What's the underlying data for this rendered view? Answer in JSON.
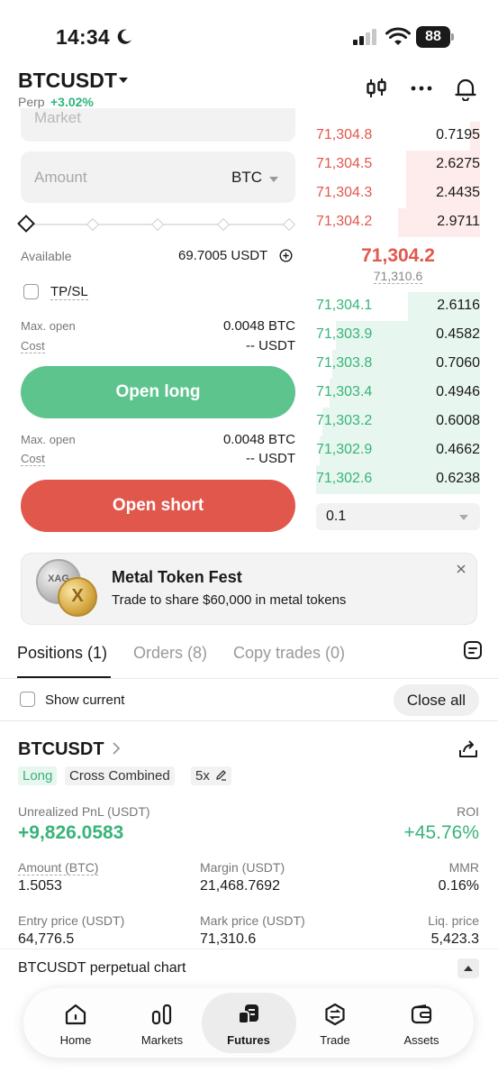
{
  "status": {
    "time": "14:34",
    "battery": "88"
  },
  "header": {
    "symbol": "BTCUSDT",
    "contract": "Perp",
    "change": "+3.02%"
  },
  "form": {
    "order_type": "Market",
    "amount_placeholder": "Amount",
    "amount_unit": "BTC",
    "available_label": "Available",
    "available_value": "69.7005 USDT",
    "tpsl_label": "TP/SL",
    "long_max_open_label": "Max. open",
    "long_max_open_value": "0.0048 BTC",
    "long_cost_label": "Cost",
    "long_cost_value": "-- USDT",
    "open_long": "Open long",
    "short_max_open_label": "Max. open",
    "short_max_open_value": "0.0048 BTC",
    "short_cost_label": "Cost",
    "short_cost_value": "-- USDT",
    "open_short": "Open short"
  },
  "orderbook": {
    "asks": [
      {
        "price": "71,304.8",
        "qty": "0.7195",
        "depth": 0.06
      },
      {
        "price": "71,304.5",
        "qty": "2.6275",
        "depth": 0.45
      },
      {
        "price": "71,304.3",
        "qty": "2.4435",
        "depth": 0.45
      },
      {
        "price": "71,304.2",
        "qty": "2.9711",
        "depth": 0.5
      }
    ],
    "last_price": "71,304.2",
    "mark_price": "71,310.6",
    "bids": [
      {
        "price": "71,304.1",
        "qty": "2.6116",
        "depth": 0.44
      },
      {
        "price": "71,303.9",
        "qty": "0.4582",
        "depth": 0.88
      },
      {
        "price": "71,303.8",
        "qty": "0.7060",
        "depth": 0.9
      },
      {
        "price": "71,303.4",
        "qty": "0.4946",
        "depth": 0.92
      },
      {
        "price": "71,303.2",
        "qty": "0.6008",
        "depth": 0.96
      },
      {
        "price": "71,302.9",
        "qty": "0.4662",
        "depth": 0.98
      },
      {
        "price": "71,302.6",
        "qty": "0.6238",
        "depth": 1.0
      }
    ],
    "precision": "0.1"
  },
  "banner": {
    "title": "Metal Token Fest",
    "subtitle": "Trade to share $60,000 in metal tokens",
    "coin1": "XAG",
    "coin2": "X"
  },
  "tabs": {
    "positions": "Positions (1)",
    "orders": "Orders (8)",
    "copy_trades": "Copy trades (0)"
  },
  "filters": {
    "show_current": "Show current",
    "close_all": "Close all"
  },
  "position": {
    "symbol": "BTCUSDT",
    "side": "Long",
    "margin_mode": "Cross Combined",
    "leverage": "5x",
    "pnl_label": "Unrealized PnL (USDT)",
    "pnl_value": "+9,826.0583",
    "roi_label": "ROI",
    "roi_value": "+45.76%",
    "amount_label": "Amount (BTC)",
    "amount_value": "1.5053",
    "margin_label": "Margin (USDT)",
    "margin_value": "21,468.7692",
    "mmr_label": "MMR",
    "mmr_value": "0.16%",
    "entry_label": "Entry price (USDT)",
    "entry_value": "64,776.5",
    "mark_label": "Mark price (USDT)",
    "mark_value": "71,310.6",
    "liq_label": "Liq. price",
    "liq_value": "5,423.3"
  },
  "chart_bar": {
    "title": "BTCUSDT perpetual chart"
  },
  "nav": {
    "home": "Home",
    "markets": "Markets",
    "futures": "Futures",
    "trade": "Trade",
    "assets": "Assets"
  }
}
